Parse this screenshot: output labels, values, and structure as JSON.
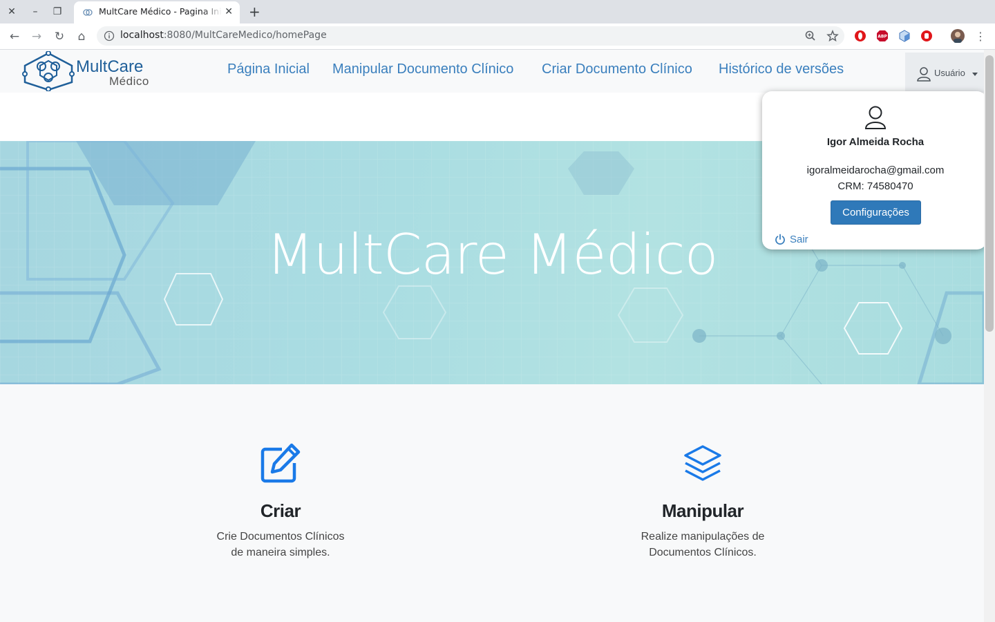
{
  "browser": {
    "tab_title": "MultCare Médico - Pagina Inicial",
    "url_host": "localhost",
    "url_rest": ":8080/MultCareMedico/homePage"
  },
  "navbar": {
    "logo_line1": "MultCare",
    "logo_line2": "Médico",
    "links": [
      "Página Inicial",
      "Manipular Documento Clínico",
      "Criar Documento Clínico",
      "Histórico de versões"
    ],
    "user_label": "Usuário"
  },
  "hero": {
    "title": "MultCare Médico"
  },
  "features": [
    {
      "icon": "edit-icon",
      "title": "Criar",
      "description": "Crie Documentos Clínicos\nde maneira simples."
    },
    {
      "icon": "layers-icon",
      "title": "Manipular",
      "description": "Realize manipulações de\nDocumentos Clínicos."
    }
  ],
  "user_dropdown": {
    "name": "Igor Almeida Rocha",
    "email": "igoralmeidarocha@gmail.com",
    "crm": "CRM: 74580470",
    "settings_label": "Configurações",
    "logout_label": "Sair"
  },
  "colors": {
    "brand_blue": "#3a7fbd",
    "button_blue": "#2f79b9",
    "icon_blue": "#1a7ae8",
    "hero_teal": "#aadde2"
  }
}
